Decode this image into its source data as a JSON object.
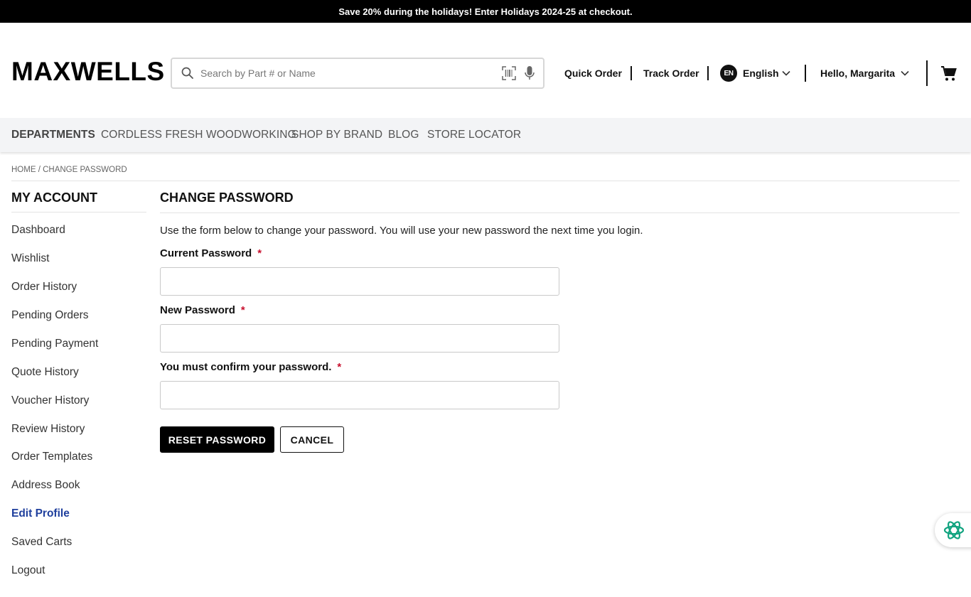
{
  "promo": {
    "text": "Save 20% during the holidays! Enter Holidays 2024-25 at checkout."
  },
  "header": {
    "logo": "MAXWELLS",
    "search_placeholder": "Search by Part # or Name",
    "quick_order": "Quick Order",
    "track_order": "Track Order",
    "language_code": "EN",
    "language": "English",
    "greeting": "Hello, Margarita"
  },
  "nav": {
    "items": [
      "DEPARTMENTS",
      "CORDLESS FRESH WOODWORKING",
      "SHOP BY BRAND",
      "BLOG",
      "STORE LOCATOR"
    ]
  },
  "breadcrumb": {
    "text": "HOME / CHANGE PASSWORD"
  },
  "sidebar": {
    "title": "MY ACCOUNT",
    "items": [
      {
        "label": "Dashboard"
      },
      {
        "label": "Wishlist"
      },
      {
        "label": "Order History"
      },
      {
        "label": "Pending Orders"
      },
      {
        "label": "Pending Payment"
      },
      {
        "label": "Quote History"
      },
      {
        "label": "Voucher History"
      },
      {
        "label": "Review History"
      },
      {
        "label": "Order Templates"
      },
      {
        "label": "Address Book"
      },
      {
        "label": "Edit Profile",
        "active": true
      },
      {
        "label": "Saved Carts"
      },
      {
        "label": "Logout"
      }
    ]
  },
  "main": {
    "title": "CHANGE PASSWORD",
    "intro": "Use the form below to change your password. You will use your new password the next time you login.",
    "current_password_label": "Current Password",
    "new_password_label": "New Password",
    "confirm_password_label": "You must confirm your password.",
    "required_mark": "*",
    "current_password_value": "",
    "new_password_value": "",
    "confirm_password_value": "",
    "reset_button": "RESET PASSWORD",
    "cancel_button": "CANCEL"
  },
  "colors": {
    "promo_bg": "#000000",
    "nav_bg": "#f3f4f6",
    "active_link": "#1f3f9d",
    "required": "#c8102e",
    "chat_accent": "#10a37f"
  },
  "icons": {
    "search": "search-icon",
    "barcode": "barcode-scan-icon",
    "mic": "microphone-icon",
    "chevron": "chevron-down-icon",
    "cart": "shopping-cart-icon",
    "chat": "chat-assistant-icon"
  }
}
